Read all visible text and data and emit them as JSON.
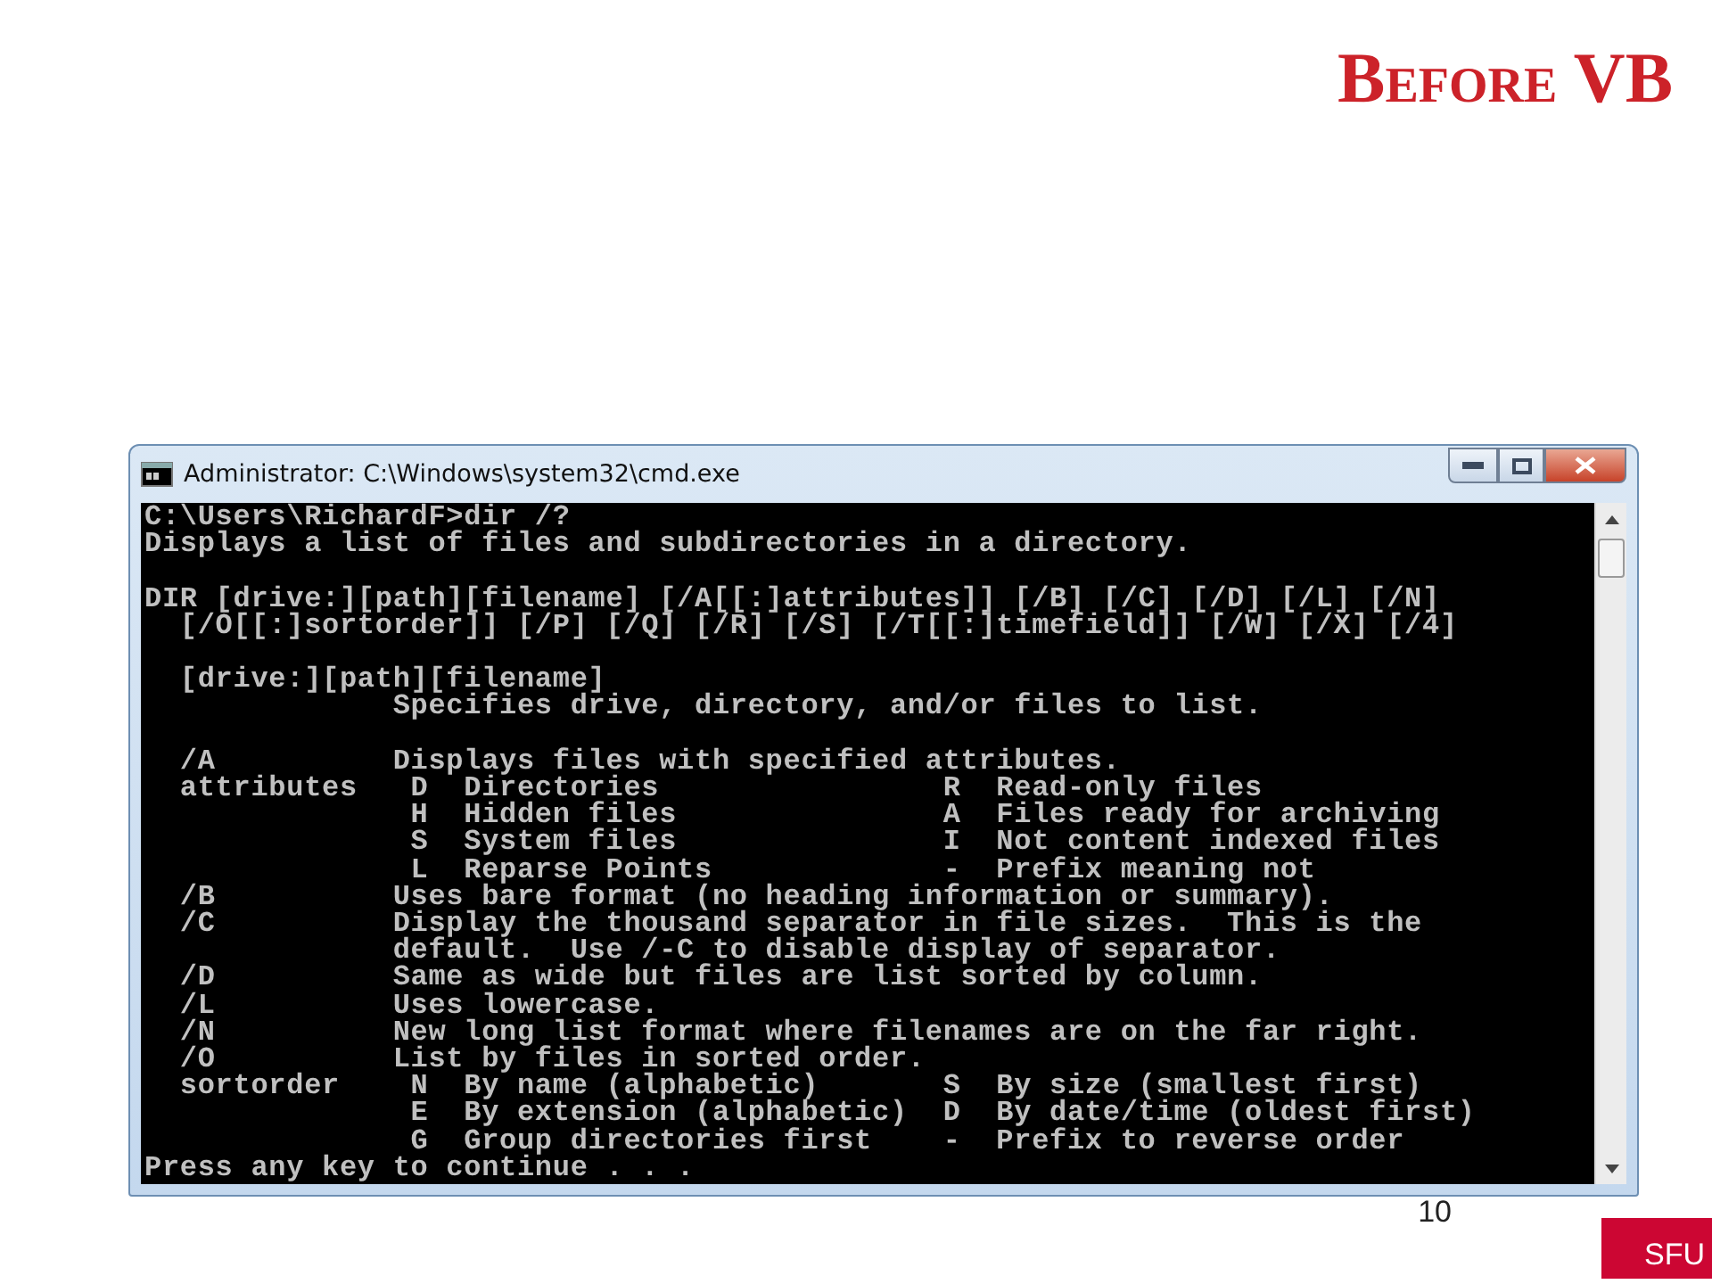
{
  "slide": {
    "title": "Before VB",
    "page_number": "10",
    "logo_text": "SFU"
  },
  "window": {
    "title": "Administrator: C:\\Windows\\system32\\cmd.exe"
  },
  "console": {
    "blocks": [
      [
        "C:\\Users\\RichardF>dir /?",
        "Displays a list of files and subdirectories in a directory."
      ],
      [
        "DIR [drive:][path][filename] [/A[[:]attributes]] [/B] [/C] [/D] [/L] [/N]",
        "  [/O[[:]sortorder]] [/P] [/Q] [/R] [/S] [/T[[:]timefield]] [/W] [/X] [/4]"
      ],
      [
        "  [drive:][path][filename]",
        "              Specifies drive, directory, and/or files to list."
      ],
      [
        "  /A          Displays files with specified attributes.",
        "  attributes   D  Directories                R  Read-only files",
        "               H  Hidden files               A  Files ready for archiving",
        "               S  System files               I  Not content indexed files",
        "               L  Reparse Points             -  Prefix meaning not",
        "  /B          Uses bare format (no heading information or summary).",
        "  /C          Display the thousand separator in file sizes.  This is the",
        "              default.  Use /-C to disable display of separator.",
        "  /D          Same as wide but files are list sorted by column.",
        "  /L          Uses lowercase.",
        "  /N          New long list format where filenames are on the far right.",
        "  /O          List by files in sorted order.",
        "  sortorder    N  By name (alphabetic)       S  By size (smallest first)",
        "               E  By extension (alphabetic)  D  By date/time (oldest first)",
        "               G  Group directories first    -  Prefix to reverse order",
        "Press any key to continue . . ."
      ]
    ]
  }
}
